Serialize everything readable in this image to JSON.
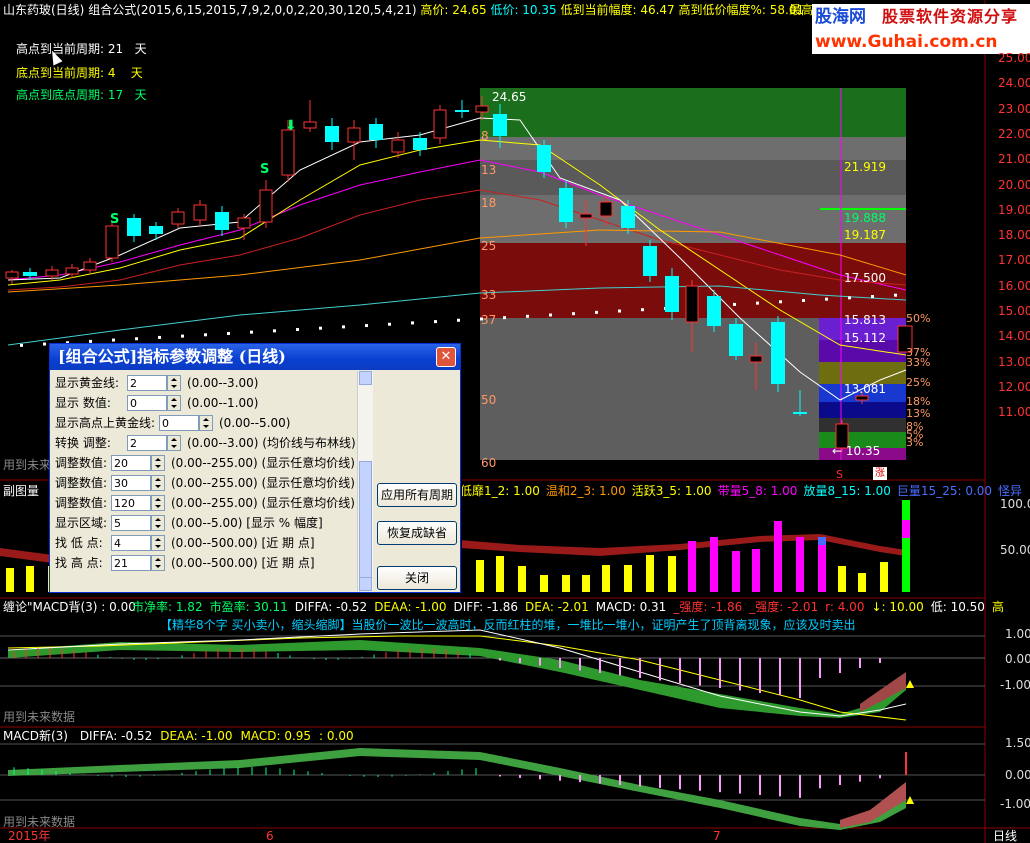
{
  "header": {
    "stock": "山东药玻(日线)",
    "formula": "组合公式(2015,6,15,2015,7,9,2,0,0,2,20,30,120,5,4,21)",
    "high_label": "高价: 24.65",
    "low_label": "低价: 10.35",
    "drop_label": "低到当前幅度: 46.47",
    "range_label": "高到低价幅度%: 58.01",
    "extra": "最高"
  },
  "logo": {
    "name": "股海网",
    "slogan": "股票软件资源分享",
    "url": "www.Guhai.com.cn"
  },
  "info": [
    {
      "label": "高点到当前周期: 21",
      "unit": "天"
    },
    {
      "label": "底点到当前周期: 4",
      "unit": "天"
    },
    {
      "label": "高点到底点周期: 17",
      "unit": "天"
    }
  ],
  "price_axis": [
    "25.00",
    "24.00",
    "23.00",
    "22.00",
    "21.00",
    "20.00",
    "19.00",
    "18.00",
    "17.00",
    "16.00",
    "15.00",
    "14.00",
    "13.00",
    "12.00",
    "11.00"
  ],
  "fib_levels": [
    "8",
    "13",
    "18",
    "25",
    "33",
    "37",
    "50",
    "60"
  ],
  "price_labels": {
    "high": "24.65",
    "low": "10.35",
    "p1": "21.919",
    "p2": "19.888",
    "p3": "19.187",
    "p4": "17.500",
    "p5": "15.813",
    "p6": "15.112",
    "p7": "13.081"
  },
  "pct_labels": [
    "50%",
    "37%",
    "33%",
    "25%",
    "18%",
    "13%",
    "8%",
    "5%",
    "3%"
  ],
  "markers": {
    "s": "S",
    "sell": "S",
    "buy": "涨"
  },
  "future_note": "用到未来数据",
  "panel2": {
    "title": "副图量",
    "legend": [
      {
        "text": "低靡1_2: 1.00",
        "color": "#ffff00"
      },
      {
        "text": "温和2_3: 1.00",
        "color": "#ff9900"
      },
      {
        "text": "活跃3_5: 1.00",
        "color": "#ffff00"
      },
      {
        "text": "带量5_8: 1.00",
        "color": "#ff00ff"
      },
      {
        "text": "放量8_15: 1.00",
        "color": "#00ffff"
      },
      {
        "text": "巨量15_25: 0.00",
        "color": "#4a6cff"
      },
      {
        "text": "怪异",
        "color": "#4a6cff"
      }
    ],
    "axis": [
      "100.00",
      "50.00"
    ]
  },
  "panel3": {
    "title": "缠论\"MACD背(3) : 0.00",
    "values": [
      {
        "text": "市净率: 1.82",
        "color": "#00ff66"
      },
      {
        "text": "市盈率: 30.11",
        "color": "#00ff66"
      },
      {
        "text": "DIFFA: -0.52",
        "color": "#ffffff"
      },
      {
        "text": "DEAA: -1.00",
        "color": "#ffff00"
      },
      {
        "text": "DIFF: -1.86",
        "color": "#ffffff"
      },
      {
        "text": "DEA: -2.01",
        "color": "#ffff00"
      },
      {
        "text": "MACD: 0.31",
        "color": "#ffffff"
      },
      {
        "text": "_强度: -1.86",
        "color": "#ff3333"
      },
      {
        "text": "_强度: -2.01",
        "color": "#ff3333"
      },
      {
        "text": "r: 4.00",
        "color": "#ff3333"
      },
      {
        "text": "↓: 10.00",
        "color": "#ffff00"
      },
      {
        "text": "低: 10.50",
        "color": "#ffffff"
      },
      {
        "text": "高",
        "color": "#ffff00"
      }
    ],
    "banner": "【精华8个字 买小卖小，缩头缩脚】当股价一波比一波高时，反而红柱的堆，一堆比一堆小，证明产生了顶背离现象，应该及时卖出",
    "axis": [
      "1.00",
      "0.00",
      "-1.00"
    ]
  },
  "panel4": {
    "title": "MACD新(3)",
    "values": [
      {
        "text": "DIFFA: -0.52",
        "color": "#ffffff"
      },
      {
        "text": "DEAA: -1.00",
        "color": "#ffff00"
      },
      {
        "text": "MACD: 0.95",
        "color": "#ffff00"
      },
      {
        "text": ": 0.00",
        "color": "#ffff00"
      }
    ],
    "axis": [
      "1.50",
      "0.00",
      "-1.00"
    ]
  },
  "time_axis": {
    "year": "2015年",
    "m6": "6",
    "m7": "7",
    "period": "日线"
  },
  "dialog": {
    "title": "[组合公式]指标参数调整 (日线)",
    "close": "✕",
    "rows": [
      {
        "label": "显示黄金线:",
        "value": "2",
        "range": "(0.00--3.00)"
      },
      {
        "label": "显示   数值:",
        "value": "0",
        "range": "(0.00--1.00)"
      },
      {
        "label": "显示高点上黄金线:",
        "value": "0",
        "range": "(0.00--5.00)"
      },
      {
        "label": "转换   调整:",
        "value": "2",
        "range": "(0.00--3.00) (均价线与布林线)"
      },
      {
        "label": "调整数值:",
        "value": "20",
        "range": "(0.00--255.00) (显示任意均价线)"
      },
      {
        "label": "调整数值:",
        "value": "30",
        "range": "(0.00--255.00) (显示任意均价线)"
      },
      {
        "label": "调整数值:",
        "value": "120",
        "range": "(0.00--255.00) (显示任意均价线)"
      },
      {
        "label": "显示区域:",
        "value": "5",
        "range": "(0.00--5.00) [显示 % 幅度]"
      },
      {
        "label": "找  低  点:",
        "value": "4",
        "range": "(0.00--500.00) [近  期  点]"
      },
      {
        "label": "找  高  点:",
        "value": "21",
        "range": "(0.00--500.00) [近  期  点]"
      }
    ],
    "buttons": {
      "apply": "应用所有周期",
      "reset": "恢复成缺省",
      "close": "关闭"
    }
  }
}
